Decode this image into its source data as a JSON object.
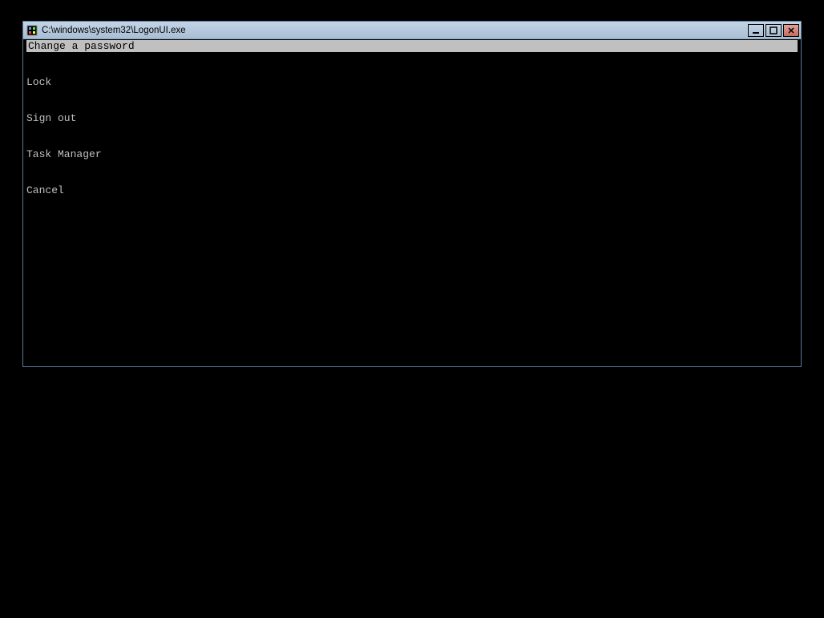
{
  "window": {
    "title": "C:\\windows\\system32\\LogonUI.exe"
  },
  "menu": {
    "selected": "Change a password",
    "items": [
      "Lock",
      "Sign out",
      "Task Manager",
      "Cancel"
    ]
  }
}
